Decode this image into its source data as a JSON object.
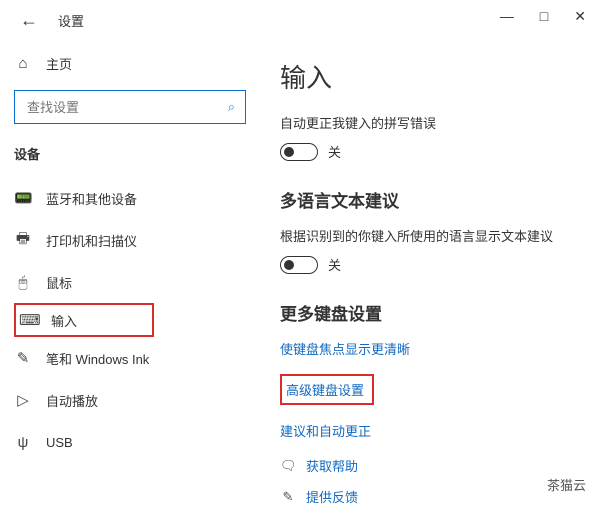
{
  "window": {
    "title": "设置",
    "controls": {
      "min": "—",
      "max": "□",
      "close": "✕"
    }
  },
  "sidebar": {
    "home": "主页",
    "search_placeholder": "查找设置",
    "section_label": "设备",
    "items": [
      {
        "label": "蓝牙和其他设备"
      },
      {
        "label": "打印机和扫描仪"
      },
      {
        "label": "鼠标"
      },
      {
        "label": "输入"
      },
      {
        "label": "笔和 Windows Ink"
      },
      {
        "label": "自动播放"
      },
      {
        "label": "USB"
      }
    ]
  },
  "main": {
    "heading": "输入",
    "spell": {
      "label": "自动更正我键入的拼写错误",
      "state": "关"
    },
    "multilang": {
      "heading": "多语言文本建议",
      "label": "根据识别到的你键入所使用的语言显示文本建议",
      "state": "关"
    },
    "more": {
      "heading": "更多键盘设置",
      "link1": "使键盘焦点显示更清晰",
      "link2": "高级键盘设置",
      "link3": "建议和自动更正"
    },
    "footer": {
      "help": "获取帮助",
      "feedback": "提供反馈"
    }
  },
  "watermark": "茶猫云"
}
